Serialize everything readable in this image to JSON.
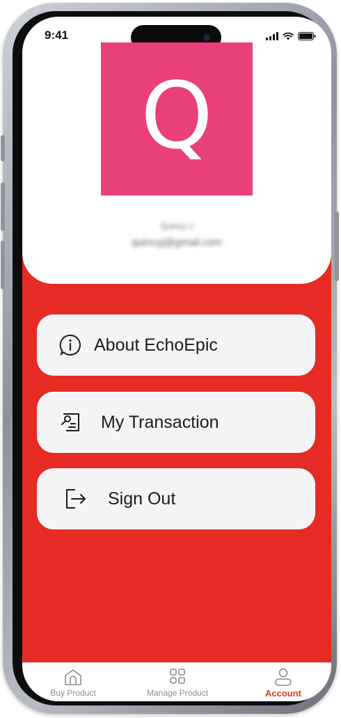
{
  "status_bar": {
    "time": "9:41"
  },
  "profile": {
    "avatar_letter": "Q",
    "avatar_color": "#e9407a",
    "name": "Quincy J",
    "email": "quincyj@gmail.com"
  },
  "menu": [
    {
      "label": "About EchoEpic",
      "icon": "info-icon"
    },
    {
      "label": "My Transaction",
      "icon": "transaction-icon"
    },
    {
      "label": "Sign Out",
      "icon": "sign-out-icon"
    }
  ],
  "bottom_nav": [
    {
      "label": "Buy Product",
      "icon": "home-icon",
      "active": false
    },
    {
      "label": "Manage Product",
      "icon": "grid-icon",
      "active": false
    },
    {
      "label": "Account",
      "icon": "account-icon",
      "active": true
    }
  ],
  "colors": {
    "background_red": "#e52b24",
    "accent": "#d93a22",
    "button_bg": "#f4f4f6"
  }
}
